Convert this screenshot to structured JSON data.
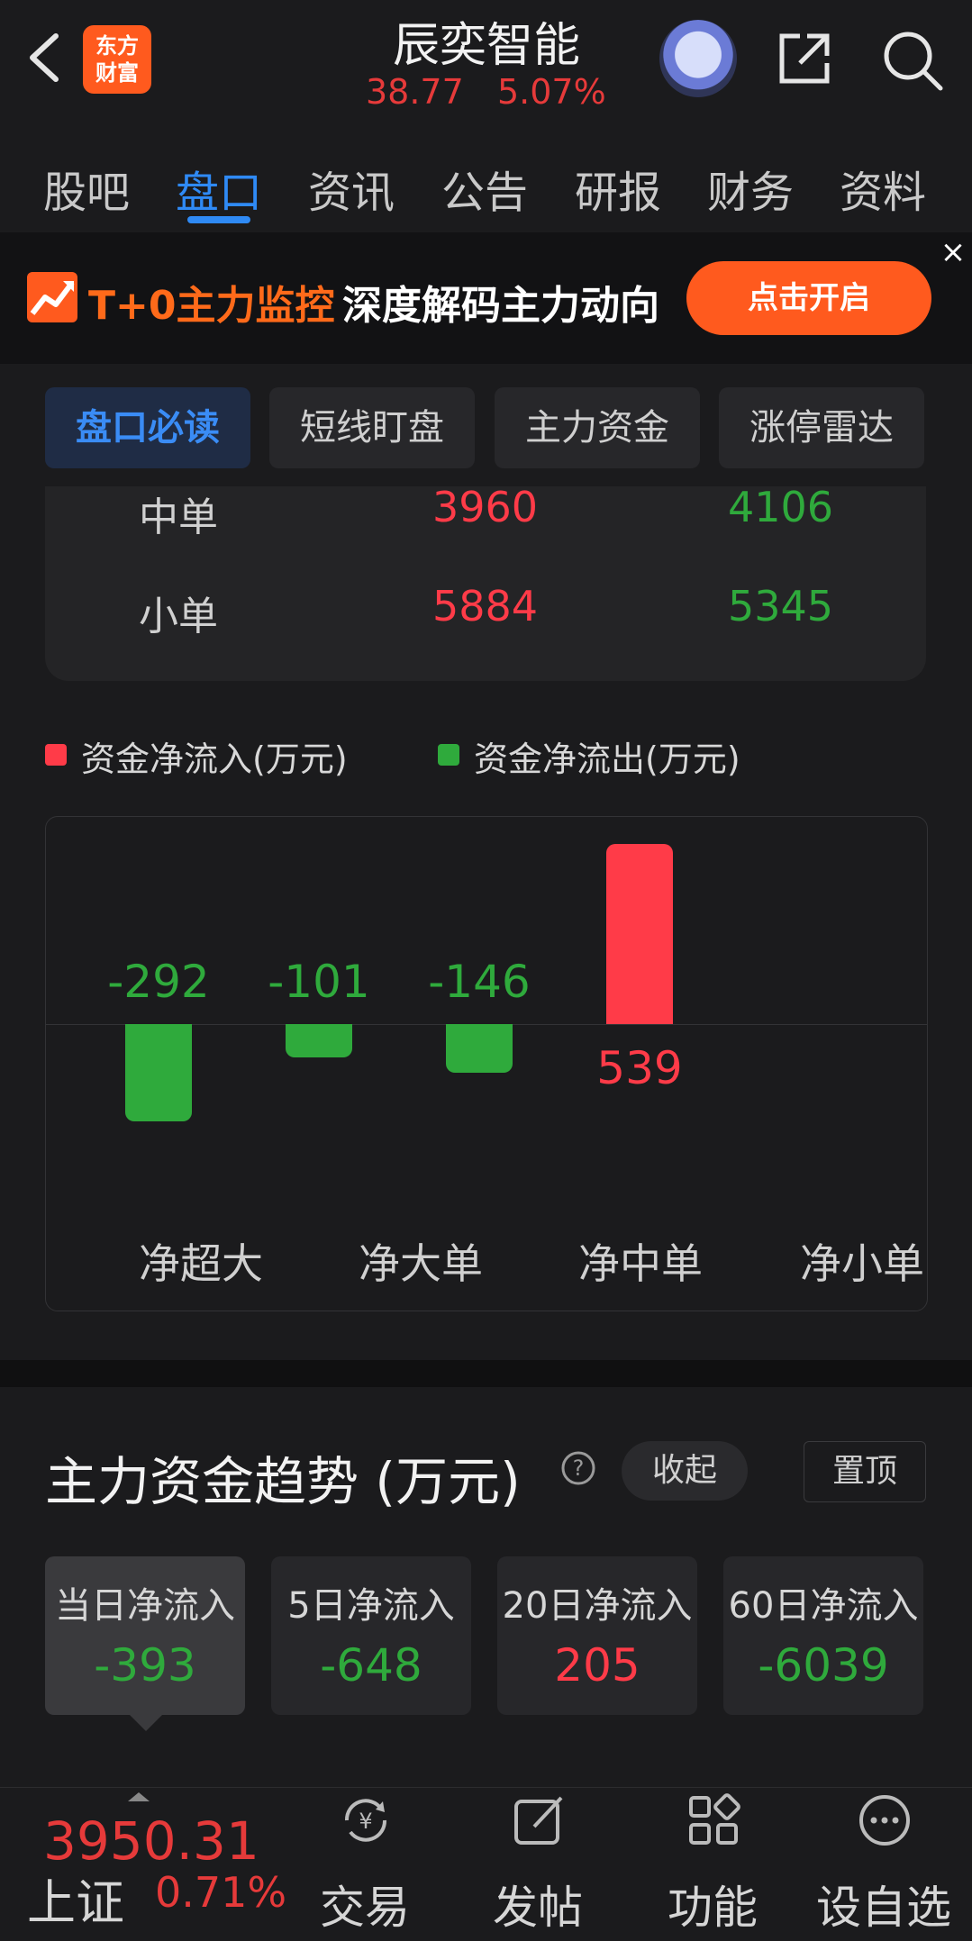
{
  "header": {
    "logo_line1": "东方",
    "logo_line2": "财富",
    "stock_name": "辰奕智能",
    "price": "38.77",
    "change_pct": "5.07%"
  },
  "tabs": [
    "股吧",
    "盘口",
    "资讯",
    "公告",
    "研报",
    "财务",
    "资料"
  ],
  "banner": {
    "text_highlight": "T+0主力监控",
    "text_rest": "深度解码主力动向",
    "button": "点击开启"
  },
  "segments": [
    "盘口必读",
    "短线盯盘",
    "主力资金",
    "涨停雷达"
  ],
  "order_table": {
    "rows": [
      {
        "label": "中单",
        "inflow": "3960",
        "outflow": "4106"
      },
      {
        "label": "小单",
        "inflow": "5884",
        "outflow": "5345"
      }
    ]
  },
  "legend": {
    "inflow": "资金净流入(万元)",
    "outflow": "资金净流出(万元)"
  },
  "chart_data": {
    "type": "bar",
    "categories": [
      "净超大",
      "净大单",
      "净中单",
      "净小单"
    ],
    "values": [
      -292,
      -101,
      -146,
      539
    ],
    "value_labels": [
      "-292",
      "-101",
      "-146",
      "539"
    ],
    "colors": {
      "positive": "#ff3b48",
      "negative": "#2faa3c"
    }
  },
  "trend_section": {
    "title": "主力资金趋势 (万元)",
    "collapse": "收起",
    "pin": "置顶",
    "cards": [
      {
        "label": "当日净流入",
        "value": "-393"
      },
      {
        "label": "5日净流入",
        "value": "-648"
      },
      {
        "label": "20日净流入",
        "value": "205"
      },
      {
        "label": "60日净流入",
        "value": "-6039"
      }
    ]
  },
  "bottom": {
    "index_value": "3950.31",
    "index_name": "上证",
    "index_pct": "0.71%",
    "nav": [
      "交易",
      "发帖",
      "功能",
      "设自选"
    ]
  },
  "colors": {
    "up": "#ff3b48",
    "down": "#2faa3c",
    "accent": "#2f8af5",
    "brand": "#ff5a1e"
  }
}
